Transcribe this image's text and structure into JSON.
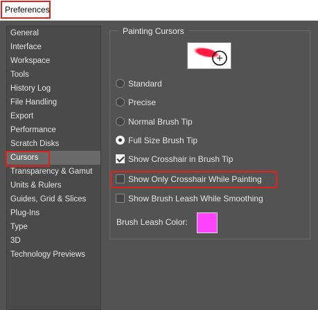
{
  "window": {
    "title": "Preferences"
  },
  "sidebar": {
    "items": [
      {
        "label": "General"
      },
      {
        "label": "Interface"
      },
      {
        "label": "Workspace"
      },
      {
        "label": "Tools"
      },
      {
        "label": "History Log"
      },
      {
        "label": "File Handling"
      },
      {
        "label": "Export"
      },
      {
        "label": "Performance"
      },
      {
        "label": "Scratch Disks"
      },
      {
        "label": "Cursors",
        "selected": true
      },
      {
        "label": "Transparency & Gamut"
      },
      {
        "label": "Units & Rulers"
      },
      {
        "label": "Guides, Grid & Slices"
      },
      {
        "label": "Plug-Ins"
      },
      {
        "label": "Type"
      },
      {
        "label": "3D"
      },
      {
        "label": "Technology Previews"
      }
    ]
  },
  "painting_cursors": {
    "legend": "Painting Cursors",
    "preview_icon": "brush-stroke-crosshair-preview",
    "options": [
      {
        "label": "Standard",
        "checked": false
      },
      {
        "label": "Precise",
        "checked": false
      },
      {
        "label": "Normal Brush Tip",
        "checked": false
      },
      {
        "label": "Full Size Brush Tip",
        "checked": true
      }
    ],
    "checkboxes": [
      {
        "label": "Show Crosshair in Brush Tip",
        "checked": true
      },
      {
        "label": "Show Only Crosshair While Painting",
        "checked": false
      },
      {
        "label": "Show Brush Leash While Smoothing",
        "checked": false
      }
    ],
    "leash_color_label": "Brush Leash Color:",
    "leash_color": "#ff44ff"
  },
  "colors": {
    "panel_bg": "#535353",
    "highlight_outline": "#e2211c"
  }
}
